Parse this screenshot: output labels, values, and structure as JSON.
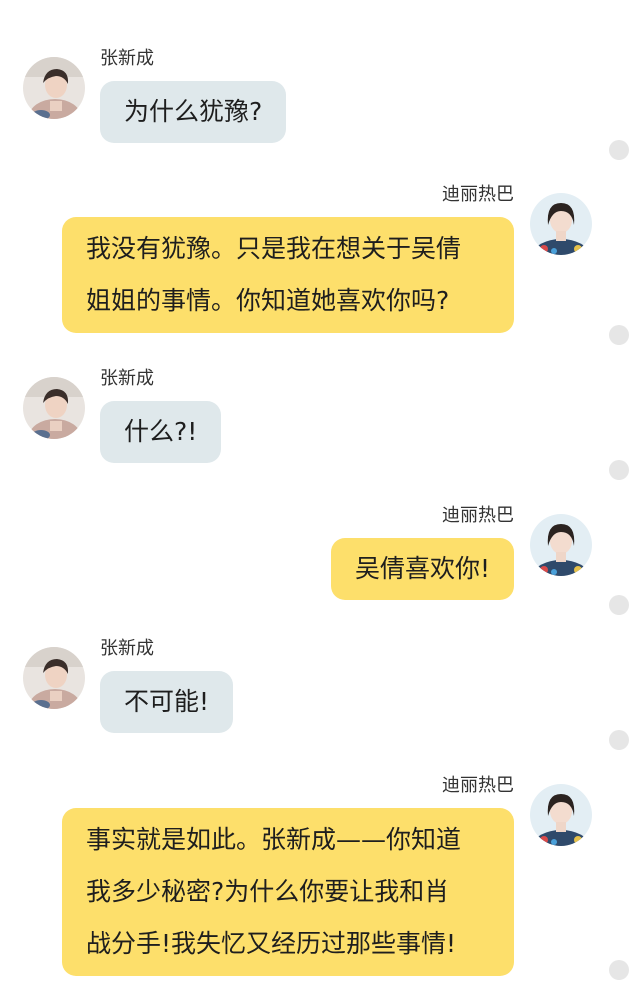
{
  "messages": [
    {
      "sender": "张新成",
      "side": "left",
      "lines": [
        "为什么犹豫?"
      ]
    },
    {
      "sender": "迪丽热巴",
      "side": "right",
      "lines": [
        "我没有犹豫。只是我在想关于吴倩",
        "姐姐的事情。你知道她喜欢你吗?"
      ]
    },
    {
      "sender": "张新成",
      "side": "left",
      "lines": [
        "什么?!"
      ]
    },
    {
      "sender": "迪丽热巴",
      "side": "right",
      "lines": [
        "吴倩喜欢你!"
      ]
    },
    {
      "sender": "张新成",
      "side": "left",
      "lines": [
        "不可能!"
      ]
    },
    {
      "sender": "迪丽热巴",
      "side": "right",
      "lines": [
        "事实就是如此。张新成——你知道",
        "我多少秘密?为什么你要让我和肖",
        "战分手!我失忆又经历过那些事情!"
      ]
    }
  ],
  "colors": {
    "left_bubble": "#dfe8eb",
    "right_bubble": "#fddf6b",
    "text": "#1e1e1e",
    "name": "#333333",
    "indicator": "#e6e6e6"
  },
  "icons": {
    "left_avatar": "avatar-zhang-xincheng",
    "right_avatar": "avatar-dilireba",
    "indicator": "circle-dot"
  }
}
